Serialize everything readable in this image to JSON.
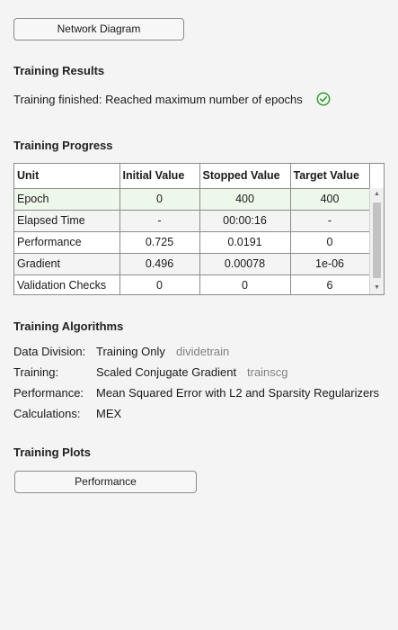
{
  "buttons": {
    "network_diagram": "Network Diagram",
    "performance": "Performance"
  },
  "results": {
    "heading": "Training Results",
    "status": "Training finished: Reached maximum number of epochs",
    "status_icon": "check-circle-icon",
    "status_color": "#2e9e2e"
  },
  "progress": {
    "heading": "Training Progress",
    "columns": [
      "Unit",
      "Initial Value",
      "Stopped Value",
      "Target Value"
    ],
    "rows": [
      {
        "unit": "Epoch",
        "initial": "0",
        "stopped": "400",
        "target": "400"
      },
      {
        "unit": "Elapsed Time",
        "initial": "-",
        "stopped": "00:00:16",
        "target": "-"
      },
      {
        "unit": "Performance",
        "initial": "0.725",
        "stopped": "0.0191",
        "target": "0"
      },
      {
        "unit": "Gradient",
        "initial": "0.496",
        "stopped": "0.00078",
        "target": "1e-06"
      },
      {
        "unit": "Validation Checks",
        "initial": "0",
        "stopped": "0",
        "target": "6"
      }
    ]
  },
  "algorithms": {
    "heading": "Training Algorithms",
    "rows": [
      {
        "label": "Data Division:",
        "value": "Training Only",
        "fn": "dividetrain"
      },
      {
        "label": "Training:",
        "value": "Scaled Conjugate Gradient",
        "fn": "trainscg"
      },
      {
        "label": "Performance:",
        "value": "Mean Squared Error with L2 and Sparsity Regularizers",
        "fn": ""
      },
      {
        "label": "Calculations:",
        "value": "MEX",
        "fn": ""
      }
    ]
  },
  "plots": {
    "heading": "Training Plots"
  }
}
